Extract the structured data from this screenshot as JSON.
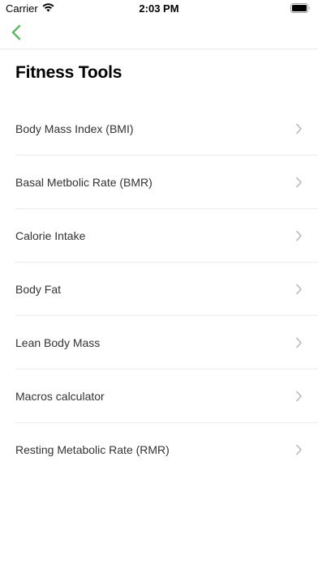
{
  "status_bar": {
    "carrier": "Carrier",
    "time": "2:03 PM",
    "wifi_icon": "wifi-icon",
    "battery_icon": "battery-icon"
  },
  "nav": {
    "back_icon": "chevron-left-icon",
    "accent_color": "#5cb85c"
  },
  "page": {
    "title": "Fitness Tools"
  },
  "tools": [
    {
      "label": "Body Mass Index (BMI)"
    },
    {
      "label": "Basal Metbolic Rate (BMR)"
    },
    {
      "label": "Calorie Intake"
    },
    {
      "label": "Body Fat"
    },
    {
      "label": "Lean Body Mass"
    },
    {
      "label": "Macros calculator"
    },
    {
      "label": "Resting Metabolic Rate (RMR)"
    }
  ]
}
